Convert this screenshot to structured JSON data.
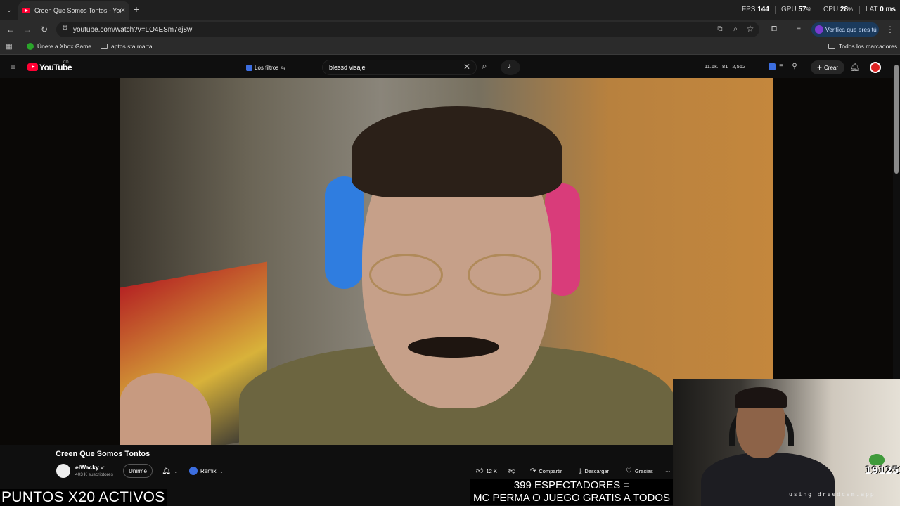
{
  "browser": {
    "tab_title": "Creen Que Somos Tontos - You",
    "url": "youtube.com/watch?v=LO4ESm7ej8w",
    "verify_label": "Verifica que eres tú",
    "bookmarks": [
      "Únete a Xbox Game...",
      "aptos sta marta"
    ],
    "all_bookmarks": "Todos los marcadores"
  },
  "perf": {
    "fps_label": "FPS",
    "fps": "144",
    "gpu_label": "GPU",
    "gpu": "57",
    "cpu_label": "CPU",
    "cpu": "28",
    "lat_label": "LAT",
    "lat": "0 ms",
    "percent": "%"
  },
  "youtube": {
    "logo": "YouTube",
    "country": "CO",
    "filters_label": "Los filtros",
    "search_value": "blessd visaje",
    "stats": [
      "11.6K",
      "81",
      "2,552"
    ],
    "create_label": "Crear"
  },
  "video": {
    "title": "Creen Que Somos Tontos",
    "channel": "elWacky",
    "subscribers": "403 K suscriptores",
    "join_label": "Unirme",
    "remix_label": "Remix",
    "likes": "12 K",
    "share_label": "Compartir",
    "download_label": "Descargar",
    "thanks_label": "Gracias"
  },
  "overlay": {
    "points": "PUNTOS X20 ACTIVOS",
    "viewers_line1": "399 ESPECTADORES =",
    "viewers_line2": "MC PERMA O JUEGO GRATIS A TODOS",
    "counter": "191251",
    "watermark": "using dreedcam.app"
  },
  "colors": {
    "accent_red": "#ff0033",
    "page_bg": "#0f0f0f",
    "chrome_bg": "#2b2b2b"
  }
}
